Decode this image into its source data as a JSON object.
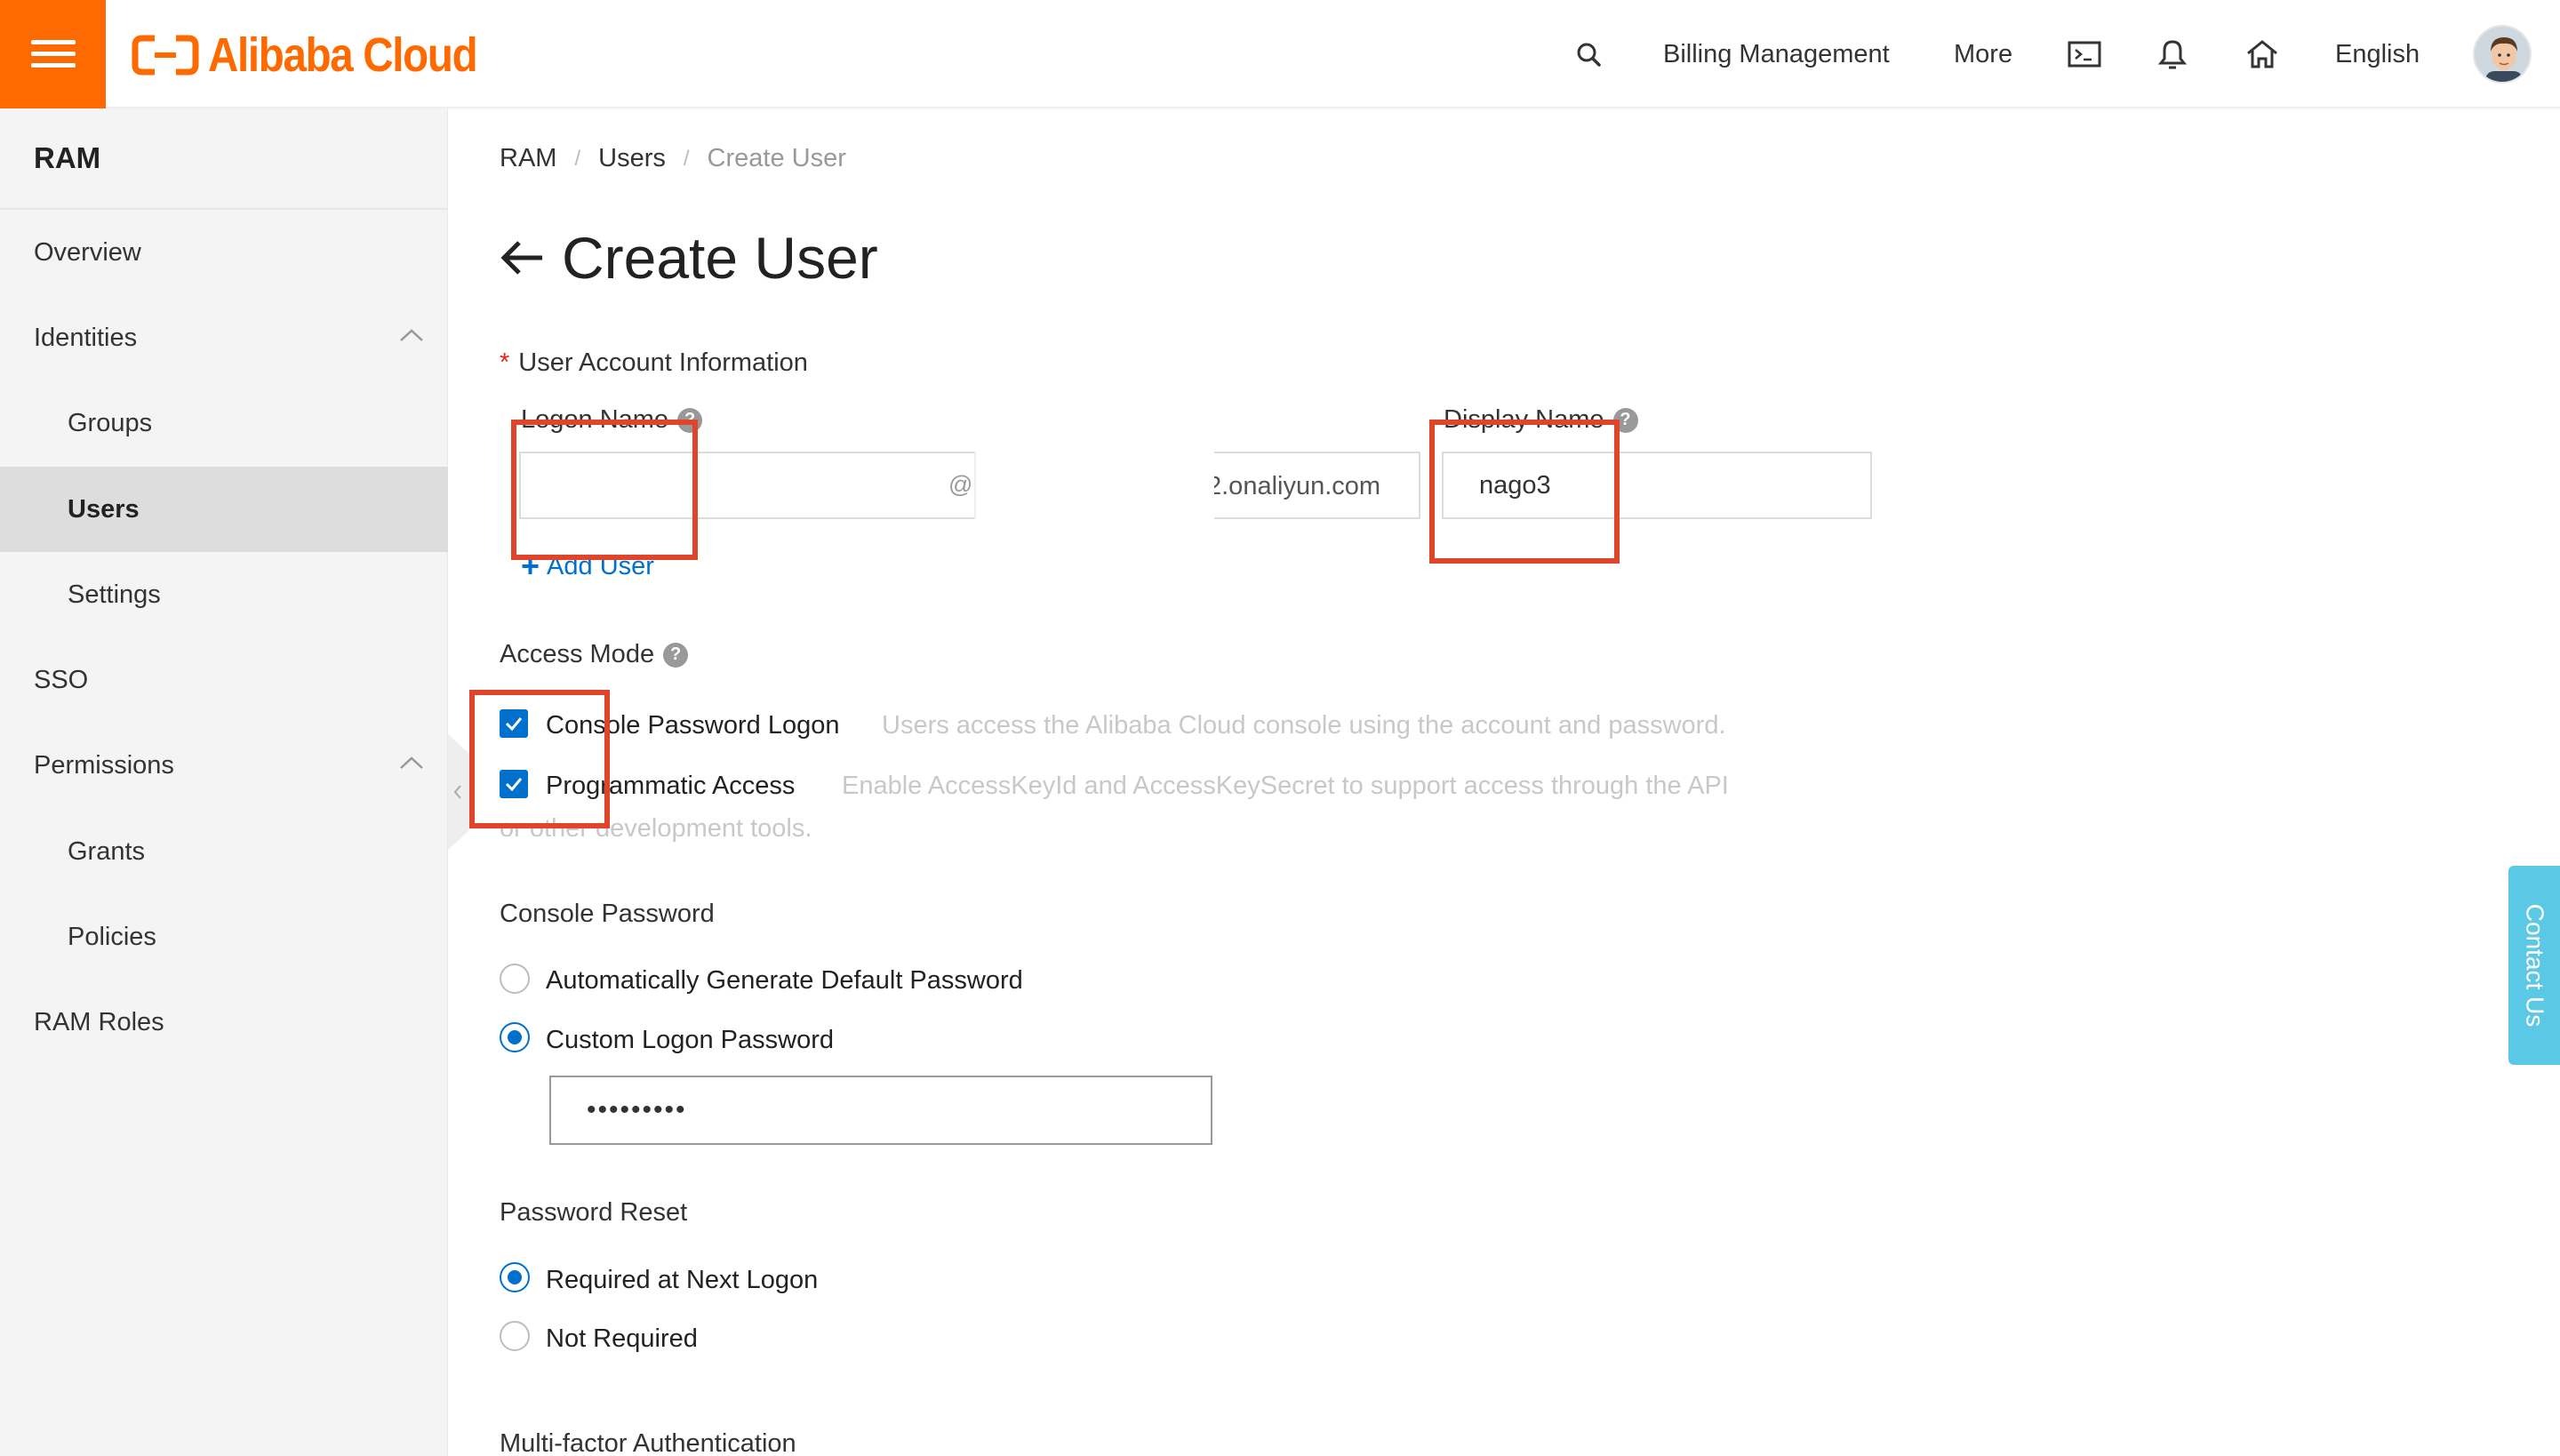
{
  "header": {
    "logo_text": "Alibaba Cloud",
    "billing": "Billing Management",
    "more": "More",
    "language": "English"
  },
  "sidebar": {
    "title": "RAM",
    "items": [
      {
        "label": "Overview"
      },
      {
        "label": "Identities"
      },
      {
        "label": "Groups"
      },
      {
        "label": "Users"
      },
      {
        "label": "Settings"
      },
      {
        "label": "SSO"
      },
      {
        "label": "Permissions"
      },
      {
        "label": "Grants"
      },
      {
        "label": "Policies"
      },
      {
        "label": "RAM Roles"
      }
    ]
  },
  "breadcrumb": [
    "RAM",
    "Users",
    "Create User"
  ],
  "page_title": "Create User",
  "form": {
    "account_section": "User Account Information",
    "logon_name_label": "Logon Name",
    "logon_name_value": "",
    "at": "@",
    "domain_suffix": "2.onaliyun.com",
    "display_name_label": "Display Name",
    "display_name_value": "nago3",
    "add_user": "Add User",
    "access_mode_label": "Access Mode",
    "console_logon_label": "Console Password Logon",
    "console_logon_desc": "Users access the Alibaba Cloud console using the account and password.",
    "programmatic_label": "Programmatic Access",
    "programmatic_desc": "Enable AccessKeyId and AccessKeySecret to support access through the API",
    "programmatic_desc_2": "or other development tools.",
    "console_password_label": "Console Password",
    "auto_password": "Automatically Generate Default Password",
    "custom_password": "Custom Logon Password",
    "password_value": "•••••••••",
    "password_reset_label": "Password Reset",
    "reset_required": "Required at Next Logon",
    "reset_not_required": "Not Required",
    "mfa_label": "Multi-factor Authentication"
  },
  "contact_us": "Contact Us",
  "colors": {
    "brand": "#ff6a00",
    "accent": "#0070cc",
    "highlight": "#e0442b",
    "contact": "#5bc8e6"
  }
}
